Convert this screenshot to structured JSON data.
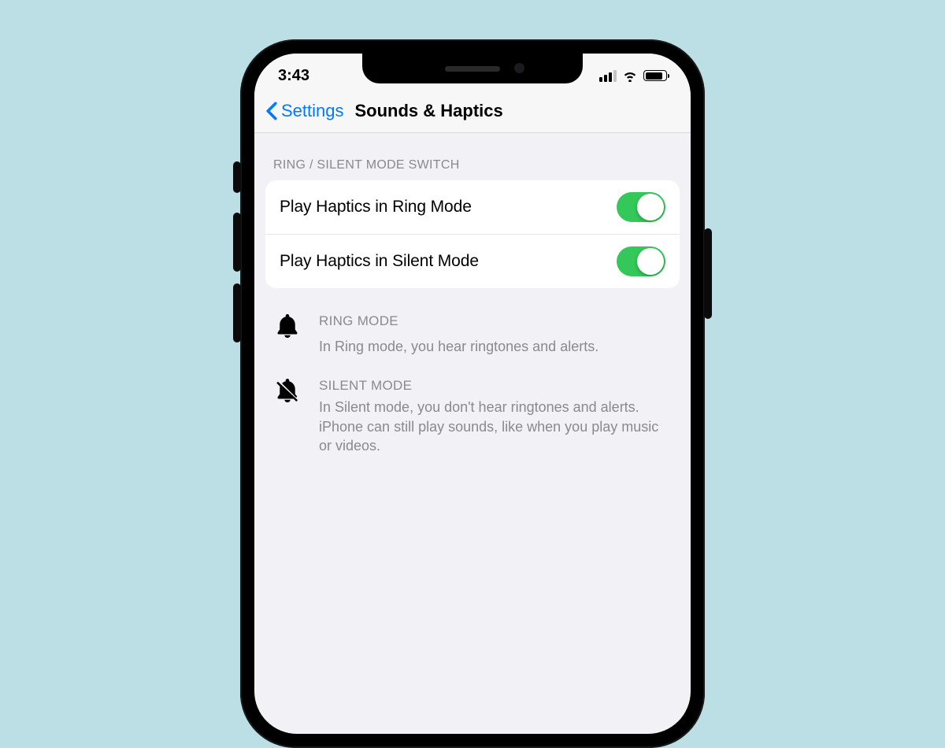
{
  "status": {
    "time": "3:43"
  },
  "nav": {
    "back_label": "Settings",
    "title": "Sounds & Haptics"
  },
  "section": {
    "header": "RING / SILENT MODE SWITCH",
    "rows": [
      {
        "label": "Play Haptics in Ring Mode",
        "on": true
      },
      {
        "label": "Play Haptics in Silent Mode",
        "on": true
      }
    ]
  },
  "modes": {
    "ring": {
      "title": "RING MODE",
      "desc": "In Ring mode, you hear ringtones and alerts."
    },
    "silent": {
      "title": "SILENT MODE",
      "desc": "In Silent mode, you don't hear ringtones and alerts. iPhone can still play sounds, like when you play music or videos."
    }
  },
  "colors": {
    "accent": "#007aff",
    "toggle_on": "#34c759",
    "page_bg": "#bcdee5"
  }
}
